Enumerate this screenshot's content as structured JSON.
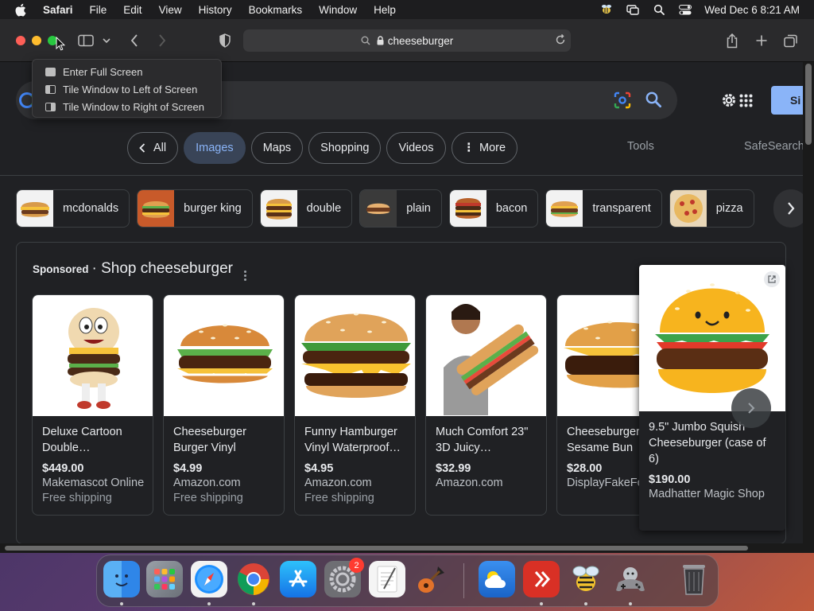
{
  "menubar": {
    "app_name": "Safari",
    "menus": [
      "File",
      "Edit",
      "View",
      "History",
      "Bookmarks",
      "Window",
      "Help"
    ],
    "clock": "Wed Dec 6  8:21 AM"
  },
  "toolbar": {
    "address_text": "cheeseburger"
  },
  "window_menu": {
    "items": [
      "Enter Full Screen",
      "Tile Window to Left of Screen",
      "Tile Window to Right of Screen"
    ]
  },
  "google": {
    "signin_label": "Si",
    "tabs": {
      "back_all": "All",
      "images": "Images",
      "maps": "Maps",
      "shopping": "Shopping",
      "videos": "Videos",
      "more": "More"
    },
    "tools": "Tools",
    "safesearch": "SafeSearch",
    "related": [
      "mcdonalds",
      "burger king",
      "double",
      "plain",
      "bacon",
      "transparent",
      "pizza"
    ]
  },
  "shopping": {
    "sponsored": "Sponsored",
    "title": "· Shop cheeseburger",
    "products": [
      {
        "title": "Deluxe Cartoon Double…",
        "price": "$449.00",
        "store": "Makemascot Online",
        "shipping": "Free shipping"
      },
      {
        "title": "Cheeseburger Burger Vinyl Stick…",
        "price": "$4.99",
        "store": "Amazon.com",
        "shipping": "Free shipping"
      },
      {
        "title": "Funny Hamburger Vinyl Waterproof…",
        "price": "$4.95",
        "store": "Amazon.com",
        "shipping": "Free shipping"
      },
      {
        "title": "Much Comfort 23\" 3D Juicy…",
        "price": "$32.99",
        "store": "Amazon.com",
        "shipping": ""
      },
      {
        "title": "Cheeseburger Sesame Bun",
        "price": "$28.00",
        "store": "DisplayFakeFoo",
        "shipping": ""
      }
    ],
    "hovered": {
      "title": "9.5\" Jumbo Squish Cheeseburger (case of 6)",
      "price": "$190.00",
      "store": "Madhatter Magic Shop"
    }
  },
  "dock": {
    "settings_badge": "2"
  }
}
